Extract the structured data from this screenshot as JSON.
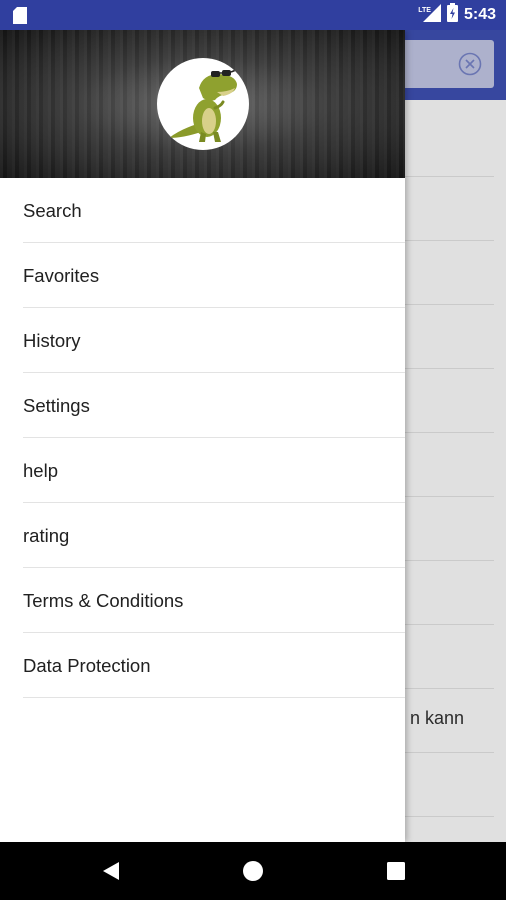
{
  "status_bar": {
    "time": "5:43",
    "network": "LTE",
    "icons": [
      "sd-card-icon",
      "signal-icon",
      "battery-icon"
    ],
    "color": "#303f9f"
  },
  "background_app": {
    "visible_fragment": "n kann",
    "accent": "#3f51b5"
  },
  "drawer": {
    "avatar": "dinosaur-logo",
    "items": [
      {
        "label": "Search"
      },
      {
        "label": "Favorites"
      },
      {
        "label": "History"
      },
      {
        "label": "Settings"
      },
      {
        "label": "help"
      },
      {
        "label": "rating"
      },
      {
        "label": "Terms & Conditions"
      },
      {
        "label": "Data Protection"
      }
    ]
  },
  "nav_bar": {
    "buttons": [
      "back-icon",
      "home-icon",
      "recents-icon"
    ]
  }
}
